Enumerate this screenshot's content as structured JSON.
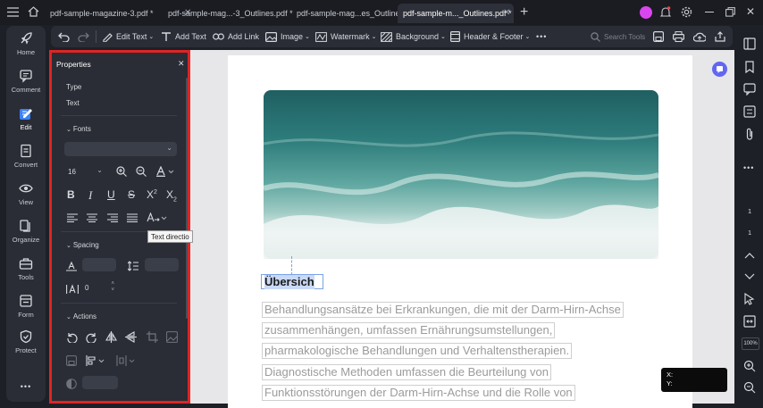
{
  "titlebar": {
    "tabs": [
      {
        "label": "pdf-sample-magazine-3.pdf *"
      },
      {
        "label": "pdf-sample-mag...-3_Outlines.pdf *"
      },
      {
        "label": "pdf-sample-mag...es_Outlines.pdf *"
      },
      {
        "label": "pdf-sample-m..._Outlines.pdf *"
      }
    ],
    "close_glyph": "✕",
    "add_glyph": "+"
  },
  "leftnav": {
    "items": [
      {
        "label": "Home",
        "icon": "rocket-icon"
      },
      {
        "label": "Comment",
        "icon": "comment-icon"
      },
      {
        "label": "Edit",
        "icon": "edit-icon"
      },
      {
        "label": "Convert",
        "icon": "convert-icon"
      },
      {
        "label": "View",
        "icon": "eye-icon"
      },
      {
        "label": "Organize",
        "icon": "organize-icon"
      },
      {
        "label": "Tools",
        "icon": "toolbox-icon"
      },
      {
        "label": "Form",
        "icon": "form-icon"
      },
      {
        "label": "Protect",
        "icon": "shield-icon"
      }
    ],
    "more": "•••"
  },
  "toolbar": {
    "edit_text": "Edit Text",
    "add_text": "Add Text",
    "add_link": "Add Link",
    "image": "Image",
    "watermark": "Watermark",
    "background": "Background",
    "header_footer": "Header & Footer",
    "more": "•••",
    "search_placeholder": "Search Tools"
  },
  "properties": {
    "title": "Properties",
    "close": "✕",
    "type_label": "Type",
    "type_value": "Text",
    "fonts_section": "Fonts",
    "font_size": "16",
    "spacing_section": "Spacing",
    "char_spacing_value": "0",
    "actions_section": "Actions",
    "tooltip": "Text directio"
  },
  "document": {
    "heading": "Übersich",
    "lines": [
      "Behandlungsansätze bei Erkrankungen, die mit der Darm-Hirn-Achse",
      "zusammenhängen, umfassen Ernährungsumstellungen,",
      "pharmakologische Behandlungen und Verhaltenstherapien.",
      "Diagnostische Methoden umfassen die Beurteilung von",
      "Funktionsstörungen der Darm-Hirn-Achse und die Rolle von"
    ],
    "coord_x": "X:",
    "coord_y": "Y:"
  },
  "rightrail": {
    "page_current": "1",
    "page_total": "1",
    "zoom": "100%"
  },
  "colors": {
    "accent": "#e02424",
    "brand": "#3b82f6",
    "avatar": "#d946ef",
    "badge": "#6366f1"
  }
}
